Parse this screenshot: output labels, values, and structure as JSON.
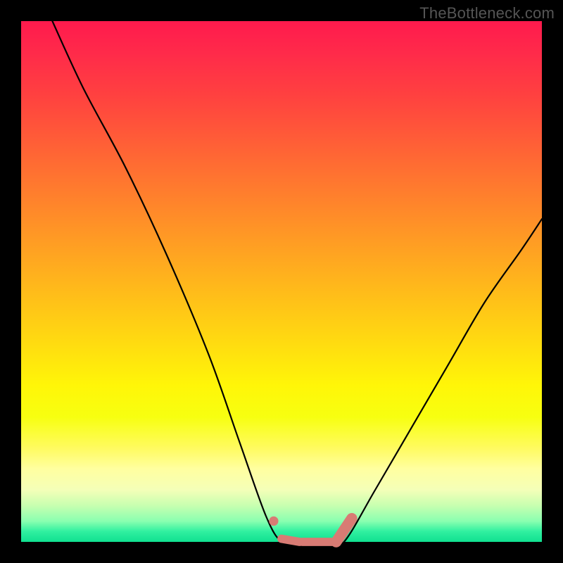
{
  "watermark": "TheBottleneck.com",
  "colors": {
    "background": "#000000",
    "curve_stroke": "#000000",
    "marker_fill": "#d87b74",
    "gradient_top": "#ff1a4d",
    "gradient_bottom": "#10e090"
  },
  "chart_data": {
    "type": "line",
    "title": "",
    "xlabel": "",
    "ylabel": "",
    "xlim": [
      0,
      100
    ],
    "ylim": [
      0,
      100
    ],
    "grid": false,
    "series": [
      {
        "name": "left-branch",
        "x": [
          6,
          12,
          20,
          28,
          36,
          42,
          47,
          50
        ],
        "values": [
          100,
          87,
          72,
          55,
          36,
          19,
          5,
          0
        ]
      },
      {
        "name": "floor",
        "x": [
          50,
          53,
          56,
          59,
          62
        ],
        "values": [
          0,
          0,
          0,
          0,
          0
        ]
      },
      {
        "name": "right-branch",
        "x": [
          62,
          68,
          75,
          82,
          89,
          96,
          100
        ],
        "values": [
          0,
          10,
          22,
          34,
          46,
          56,
          62
        ]
      }
    ],
    "markers": [
      {
        "name": "dot-left-edge",
        "x": 48.5,
        "y": 4.0,
        "r": 0.9,
        "shape": "circle"
      },
      {
        "name": "segment-left",
        "x1": 50.0,
        "y1": 0.6,
        "x2": 53.5,
        "y2": 0.0,
        "w": 1.6,
        "shape": "segment"
      },
      {
        "name": "segment-mid",
        "x1": 54.0,
        "y1": 0.0,
        "x2": 60.5,
        "y2": 0.0,
        "w": 1.6,
        "shape": "segment"
      },
      {
        "name": "segment-right",
        "x1": 60.5,
        "y1": 0.0,
        "x2": 63.5,
        "y2": 4.5,
        "w": 2.1,
        "shape": "segment"
      }
    ]
  }
}
